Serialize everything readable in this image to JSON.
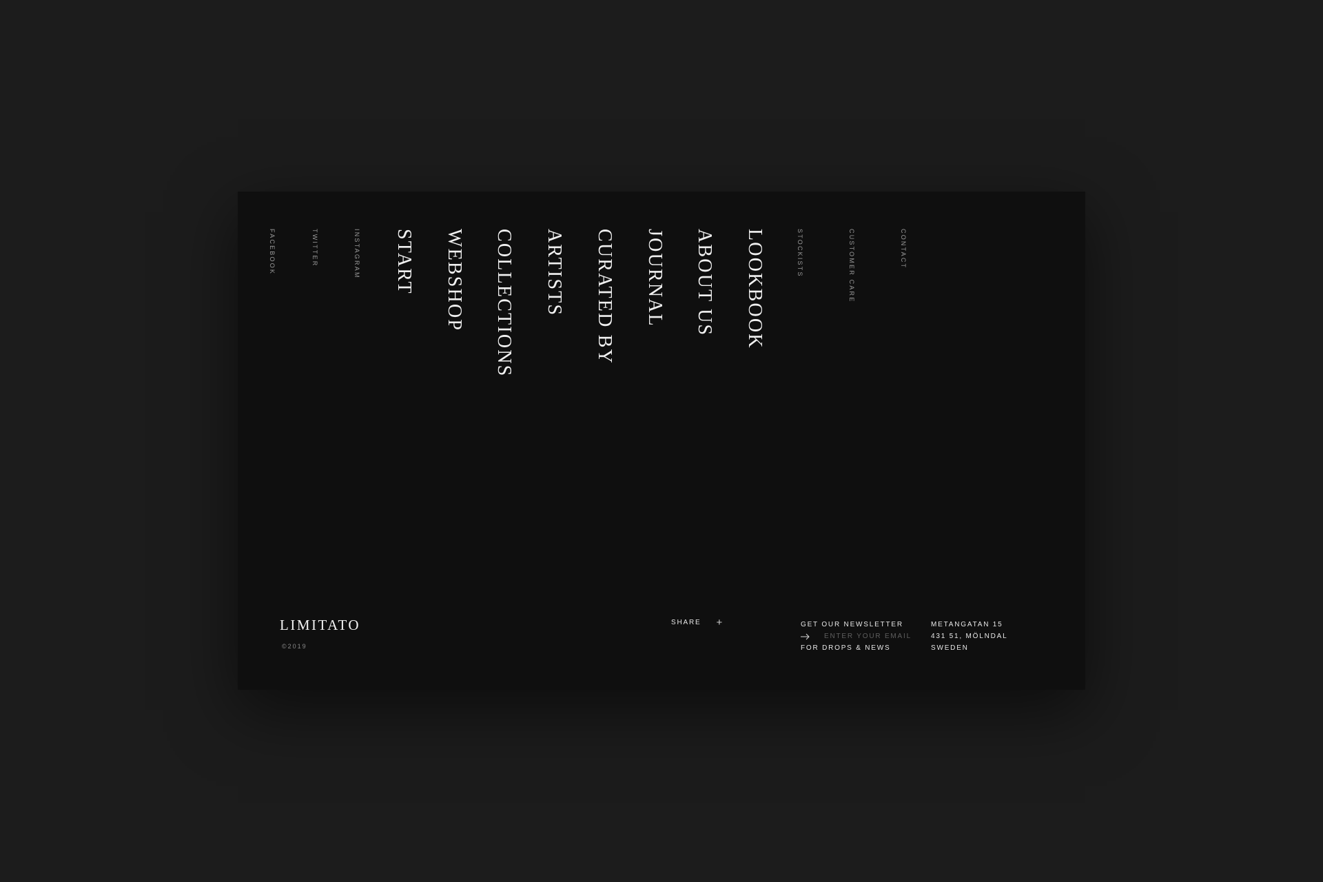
{
  "social": {
    "facebook": "FACEBOOK",
    "twitter": "TWITTER",
    "instagram": "INSTAGRAM"
  },
  "nav": {
    "start": "START",
    "webshop": "WEBSHOP",
    "collections": "COLLECTIONS",
    "artists": "ARTISTS",
    "curated_by": "CURATED BY",
    "journal": "JOURNAL",
    "about_us": "ABOUT US",
    "lookbook": "LOOKBOOK"
  },
  "secondary": {
    "stockists": "STOCKISTS",
    "customer_care": "CUSTOMER CARE",
    "contact": "CONTACT"
  },
  "footer": {
    "logo": "LIMITATO",
    "copyright": "©2019",
    "share_label": "SHARE",
    "share_icon": "+",
    "newsletter_title": "GET OUR NEWSLETTER",
    "email_placeholder": "ENTER YOUR EMAIL",
    "newsletter_subtitle": "FOR DROPS & NEWS",
    "address_line1": "METANGATAN 15",
    "address_line2": "431 51, MÖLNDAL",
    "address_line3": "SWEDEN"
  },
  "colors": {
    "page_background": "#1c1c1c",
    "panel_background": "#0f0f0f",
    "text_primary": "#f0f0f0",
    "text_muted": "#9a9a9a"
  }
}
